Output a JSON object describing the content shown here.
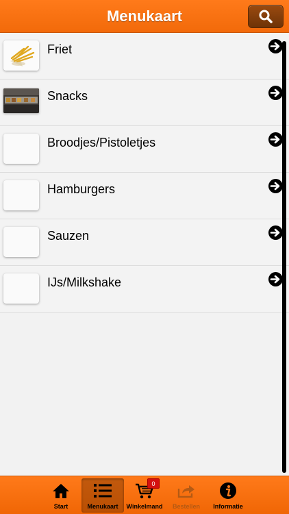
{
  "header": {
    "title": "Menukaart"
  },
  "menu": [
    {
      "label": "Friet",
      "thumb": "fries-image"
    },
    {
      "label": "Snacks",
      "thumb": "snacks-image"
    },
    {
      "label": "Broodjes/Pistoletjes",
      "thumb": "placeholder-image"
    },
    {
      "label": "Hamburgers",
      "thumb": "placeholder-image"
    },
    {
      "label": "Sauzen",
      "thumb": "placeholder-image"
    },
    {
      "label": "IJs/Milkshake",
      "thumb": "placeholder-image"
    }
  ],
  "tabs": [
    {
      "label": "Start",
      "icon": "home-icon"
    },
    {
      "label": "Menukaart",
      "icon": "list-icon",
      "active": true
    },
    {
      "label": "Winkelmand",
      "icon": "cart-icon",
      "badge": "0"
    },
    {
      "label": "Bestellen",
      "icon": "share-icon",
      "disabled": true
    },
    {
      "label": "Informatie",
      "icon": "info-icon"
    }
  ],
  "colors": {
    "accent": "#f26a0a",
    "active_tab": "#7a3305",
    "badge": "#d41010"
  }
}
